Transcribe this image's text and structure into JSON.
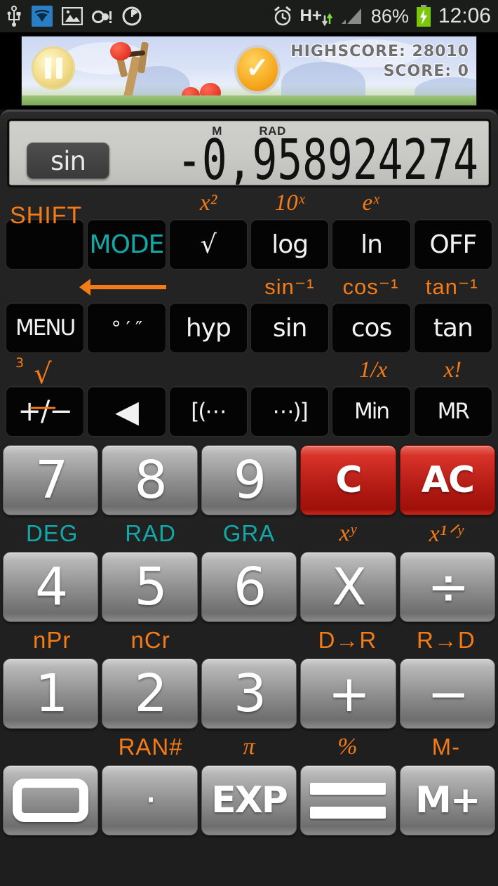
{
  "statusbar": {
    "icons": [
      "usb-icon",
      "wifi-icon",
      "image-icon",
      "voicemail-icon",
      "clock-icon"
    ],
    "alarm_icon": "alarm-icon",
    "network_type": "H+",
    "signal_icon": "signal-bars-icon",
    "battery_percent": "86%",
    "battery_icon": "battery-charging-icon",
    "time": "12:06"
  },
  "ad": {
    "highscore_label": "HIGHSCORE: 28010",
    "score_label": "SCORE:                0",
    "pause_button": "pause-button",
    "check_button": "check-button"
  },
  "display": {
    "mode_badge": "sin",
    "flag_memory": "M",
    "flag_angle": "RAD",
    "value": "-0,958924274"
  },
  "function_rows": [
    {
      "labels": [
        "SHIFT",
        "",
        "x²",
        "10ˣ",
        "eˣ",
        ""
      ],
      "keys": [
        "",
        "MODE",
        "√",
        "log",
        "ln",
        "OFF"
      ]
    },
    {
      "labels": [
        "",
        "backspace-arrow",
        "",
        "sin⁻¹",
        "cos⁻¹",
        "tan⁻¹"
      ],
      "keys": [
        "MENU",
        "° ′ ″",
        "hyp",
        "sin",
        "cos",
        "tan"
      ]
    },
    {
      "labels": [
        "∛",
        "",
        "",
        "",
        "1/x",
        "x!"
      ],
      "keys": [
        "+/−",
        "◀",
        "[(⋯",
        "⋯)]",
        "Min",
        "MR"
      ]
    }
  ],
  "keypad": [
    {
      "keys": [
        "7",
        "8",
        "9",
        "C",
        "AC"
      ],
      "colors": [
        "grey",
        "grey",
        "grey",
        "red",
        "red"
      ],
      "sublabels": [
        "DEG",
        "RAD",
        "GRA",
        "xʸ",
        "x¹ᐟʸ"
      ],
      "subcolors": [
        "teal",
        "teal",
        "teal",
        "orange",
        "orange"
      ]
    },
    {
      "keys": [
        "4",
        "5",
        "6",
        "X",
        "÷"
      ],
      "colors": [
        "grey",
        "grey",
        "grey",
        "grey",
        "grey"
      ],
      "sublabels": [
        "nPr",
        "nCr",
        "",
        "D→R",
        "R→D"
      ],
      "subcolors": [
        "orange",
        "orange",
        "orange",
        "orange",
        "orange"
      ]
    },
    {
      "keys": [
        "1",
        "2",
        "3",
        "+",
        "−"
      ],
      "colors": [
        "grey",
        "grey",
        "grey",
        "grey",
        "grey"
      ],
      "sublabels": [
        "",
        "RAN#",
        "π",
        "%",
        "M-"
      ],
      "subcolors": [
        "orange",
        "orange",
        "orange",
        "orange",
        "orange"
      ]
    },
    {
      "keys": [
        "0",
        "·",
        "EXP",
        "=",
        "M+"
      ],
      "colors": [
        "grey",
        "grey",
        "grey",
        "grey",
        "grey"
      ],
      "sublabels": [
        "",
        "",
        "",
        "",
        ""
      ],
      "subcolors": [
        "orange",
        "orange",
        "orange",
        "orange",
        "orange"
      ]
    }
  ],
  "colors": {
    "accent_orange": "#f47b16",
    "accent_teal": "#12a8a8",
    "clear_red": "#c22b22",
    "lcd_bg": "#c9c9c5"
  }
}
